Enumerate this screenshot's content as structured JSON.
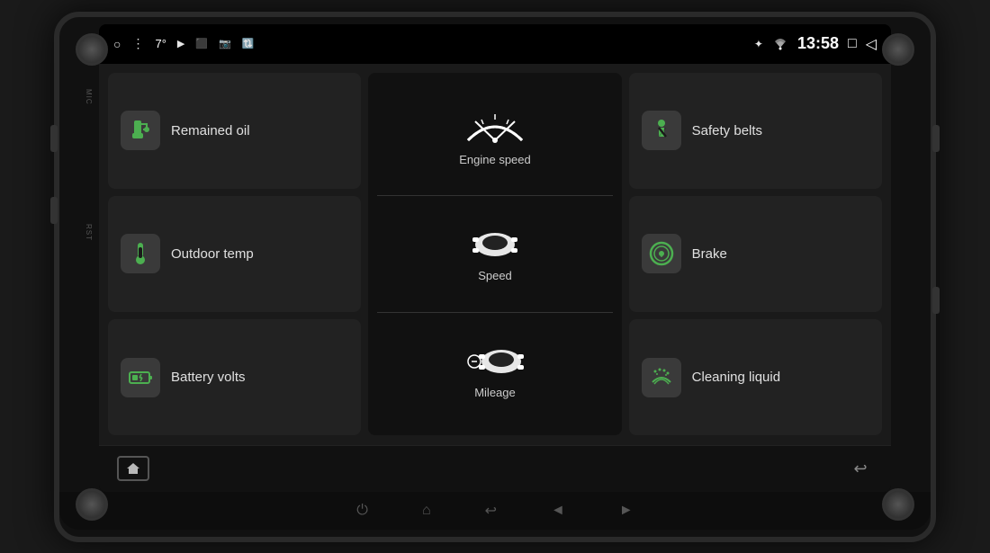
{
  "device": {
    "mic_label": "MIC",
    "rst_label": "RST"
  },
  "status_bar": {
    "home_icon": "○",
    "menu_icon": "⋮",
    "temperature": "7°",
    "play_icon": "▶",
    "camera1_icon": "⬜",
    "camera2_icon": "📷",
    "camera3_icon": "🔄",
    "bluetooth_icon": "⚡",
    "wifi_icon": "▲",
    "time": "13:58",
    "window_icon": "□",
    "back_icon": "◁"
  },
  "tiles": [
    {
      "id": "remained-oil",
      "label": "Remained oil",
      "icon_color": "#4caf50",
      "col": 1,
      "row": 1
    },
    {
      "id": "outdoor-temp",
      "label": "Outdoor temp",
      "icon_color": "#4caf50",
      "col": 1,
      "row": 2
    },
    {
      "id": "battery-volts",
      "label": "Battery volts",
      "icon_color": "#4caf50",
      "col": 1,
      "row": 3
    },
    {
      "id": "safety-belts",
      "label": "Safety belts",
      "icon_color": "#4caf50",
      "col": 3,
      "row": 1
    },
    {
      "id": "brake",
      "label": "Brake",
      "icon_color": "#4caf50",
      "col": 3,
      "row": 2
    },
    {
      "id": "cleaning-liquid",
      "label": "Cleaning liquid",
      "icon_color": "#4caf50",
      "col": 3,
      "row": 3
    }
  ],
  "center": {
    "engine_speed_label": "Engine speed",
    "speed_label": "Speed",
    "mileage_label": "Mileage"
  },
  "bottom_bar": {
    "back_arrow": "↩"
  },
  "physical_bar": {
    "power_icon": "⏻",
    "home_icon": "⌂",
    "back_icon": "↩",
    "vol_down_icon": "◄",
    "vol_up_icon": "►"
  }
}
